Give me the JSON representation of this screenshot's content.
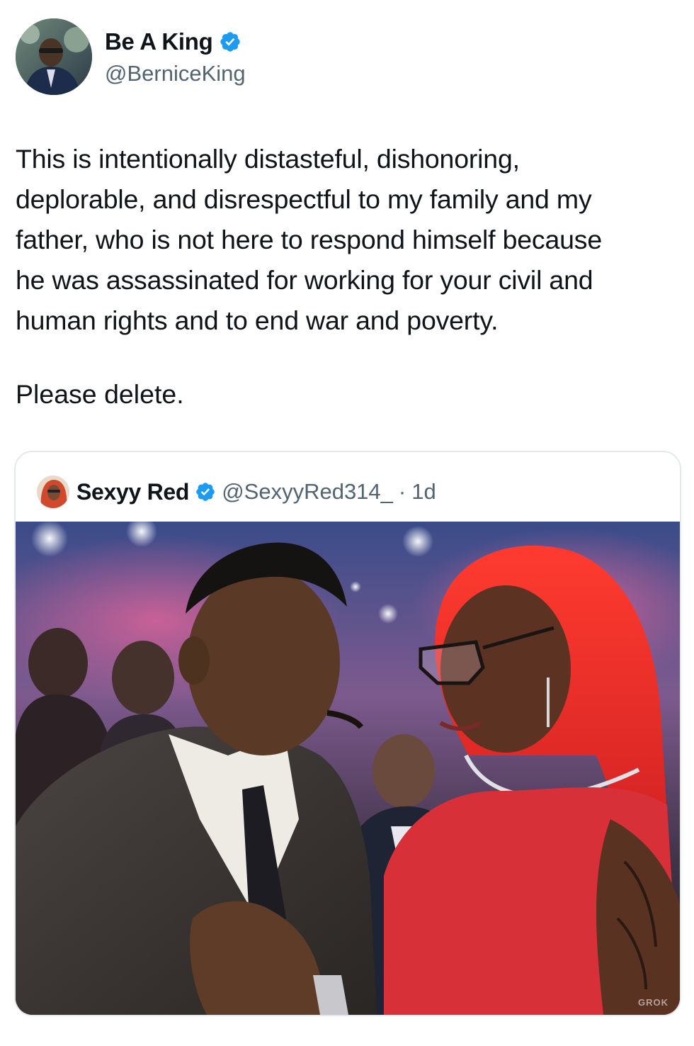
{
  "author": {
    "display_name": "Be A King",
    "handle": "@BerniceKing",
    "verified": true,
    "avatar_icon": "profile-photo"
  },
  "tweet": {
    "text": "This is intentionally distasteful, dishonoring,\ndeplorable, and disrespectful to my family and my\nfather, who is not here to respond himself because\nhe was assassinated for working for your civil and\nhuman rights and to end war and poverty.",
    "text2": "Please delete."
  },
  "quoted_tweet": {
    "display_name": "Sexyy Red",
    "handle": "@SexyyRed314_",
    "separator": "·",
    "time": "1d",
    "verified": true,
    "media_watermark": "GROK"
  },
  "colors": {
    "verified_blue": "#1d9bf0",
    "text_primary": "#0f1419",
    "text_secondary": "#536471",
    "border": "#e4e8ec"
  }
}
